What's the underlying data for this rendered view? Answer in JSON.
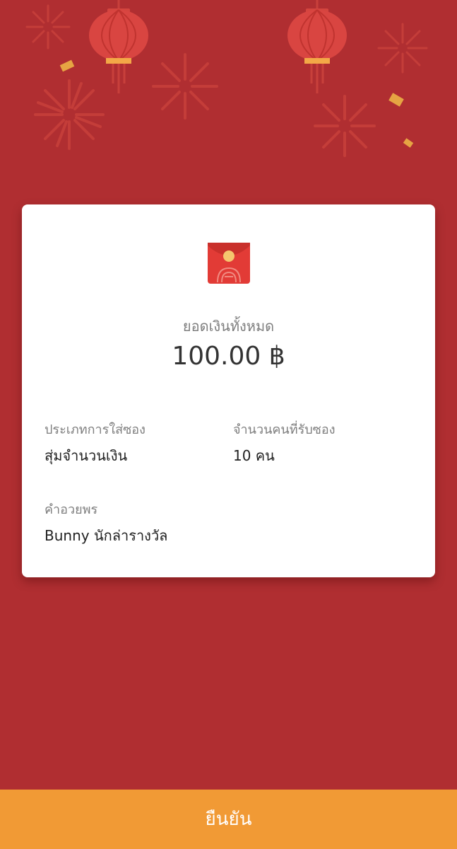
{
  "summary": {
    "total_label": "ยอดเงินทั้งหมด",
    "total_amount": "100.00 ฿"
  },
  "details": {
    "packet_type_label": "ประเภทการใส่ซอง",
    "packet_type_value": "สุ่มจำนวนเงิน",
    "recipients_label": "จำนวนคนที่รับซอง",
    "recipients_value": "10 คน",
    "greeting_label": "คำอวยพร",
    "greeting_value": "Bunny นักล่ารางวัล"
  },
  "footer": {
    "confirm_label": "ยืนยัน"
  },
  "colors": {
    "background": "#b02e31",
    "card": "#ffffff",
    "button": "#f19a35",
    "envelope": "#e23b36",
    "seal": "#f5c56e"
  },
  "icons": {
    "packet": "red-envelope-icon",
    "decorations": [
      "lantern-icon",
      "firework-icon",
      "confetti-icon"
    ]
  }
}
